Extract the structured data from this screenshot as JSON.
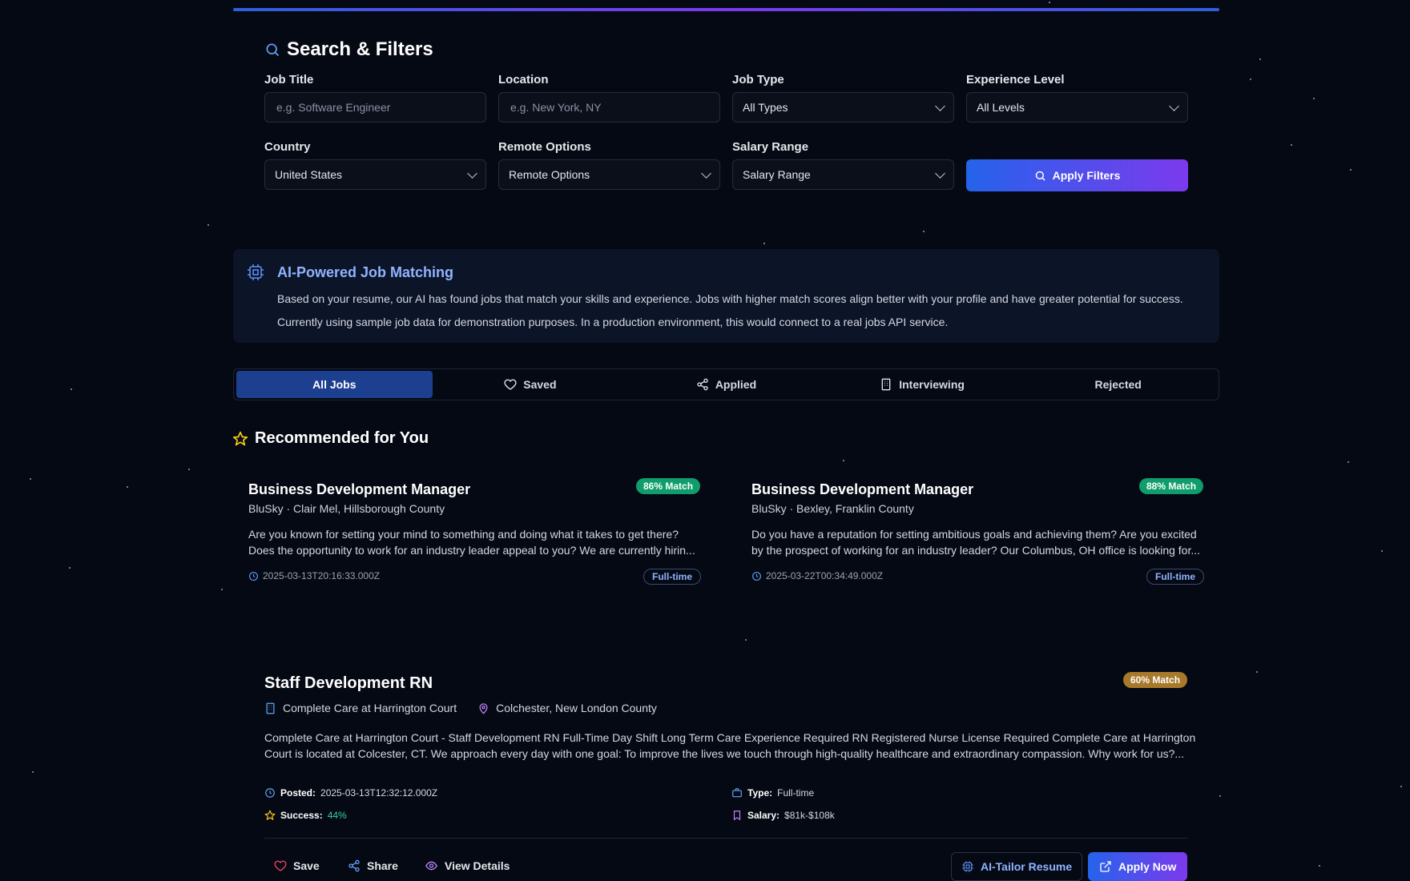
{
  "filters": {
    "title": "Search & Filters",
    "job_title": {
      "label": "Job Title",
      "placeholder": "e.g. Software Engineer"
    },
    "location": {
      "label": "Location",
      "placeholder": "e.g. New York, NY"
    },
    "job_type": {
      "label": "Job Type",
      "value": "All Types"
    },
    "experience": {
      "label": "Experience Level",
      "value": "All Levels"
    },
    "country": {
      "label": "Country",
      "value": "United States"
    },
    "remote": {
      "label": "Remote Options",
      "value": "Remote Options"
    },
    "salary": {
      "label": "Salary Range",
      "value": "Salary Range"
    },
    "apply_label": "Apply Filters"
  },
  "ai": {
    "title": "AI-Powered Job Matching",
    "line1": "Based on your resume, our AI has found jobs that match your skills and experience. Jobs with higher match scores align better with your profile and have greater potential for success.",
    "line2": "Currently using sample job data for demonstration purposes. In a production environment, this would connect to a real jobs API service."
  },
  "tabs": [
    {
      "label": "All Jobs"
    },
    {
      "label": "Saved"
    },
    {
      "label": "Applied"
    },
    {
      "label": "Interviewing"
    },
    {
      "label": "Rejected"
    }
  ],
  "recommended": {
    "title": "Recommended for You",
    "cards": [
      {
        "title": "Business Development Manager",
        "subtitle": "BluSky · Clair Mel, Hillsborough County",
        "match": "86% Match",
        "desc1": "Are you known for setting your mind to something and doing what it takes to get there?",
        "desc2": "Does the opportunity to work for an industry leader appeal to you? We are currently hirin...",
        "date": "2025-03-13T20:16:33.000Z",
        "type": "Full-time"
      },
      {
        "title": "Business Development Manager",
        "subtitle": "BluSky · Bexley, Franklin County",
        "match": "88% Match",
        "desc1": "Do you have a reputation for setting ambitious goals and achieving them? Are you excited",
        "desc2": "by the prospect of working for an industry leader? Our Columbus, OH office is looking for...",
        "date": "2025-03-22T00:34:49.000Z",
        "type": "Full-time"
      }
    ]
  },
  "job": {
    "title": "Staff Development RN",
    "match": "60% Match",
    "company": "Complete Care at Harrington Court",
    "location": "Colchester, New London County",
    "desc1": "Complete Care at Harrington Court - Staff Development RN Full-Time Day Shift Long Term Care Experience Required RN Registered Nurse License Required Complete Care at Harrington",
    "desc2": "Court is located at Colcester, CT. We approach every day with one goal: To improve the lives we touch through high-quality healthcare and extraordinary compassion. Why work for us?...",
    "posted_label": "Posted:",
    "posted": "2025-03-13T12:32:12.000Z",
    "success_label": "Success:",
    "success": "44%",
    "type_label": "Type:",
    "type": "Full-time",
    "salary_label": "Salary:",
    "salary": "$81k-$108k",
    "actions": {
      "save": "Save",
      "share": "Share",
      "view": "View Details",
      "tailor": "AI-Tailor Resume",
      "apply": "Apply Now"
    }
  },
  "colors": {
    "accent": "#2563eb",
    "accent2": "#7c3aed",
    "match_green": "#0f9d6b",
    "match_gold": "#a8792b",
    "success_green": "#34d399",
    "star_yellow": "#facc15"
  }
}
